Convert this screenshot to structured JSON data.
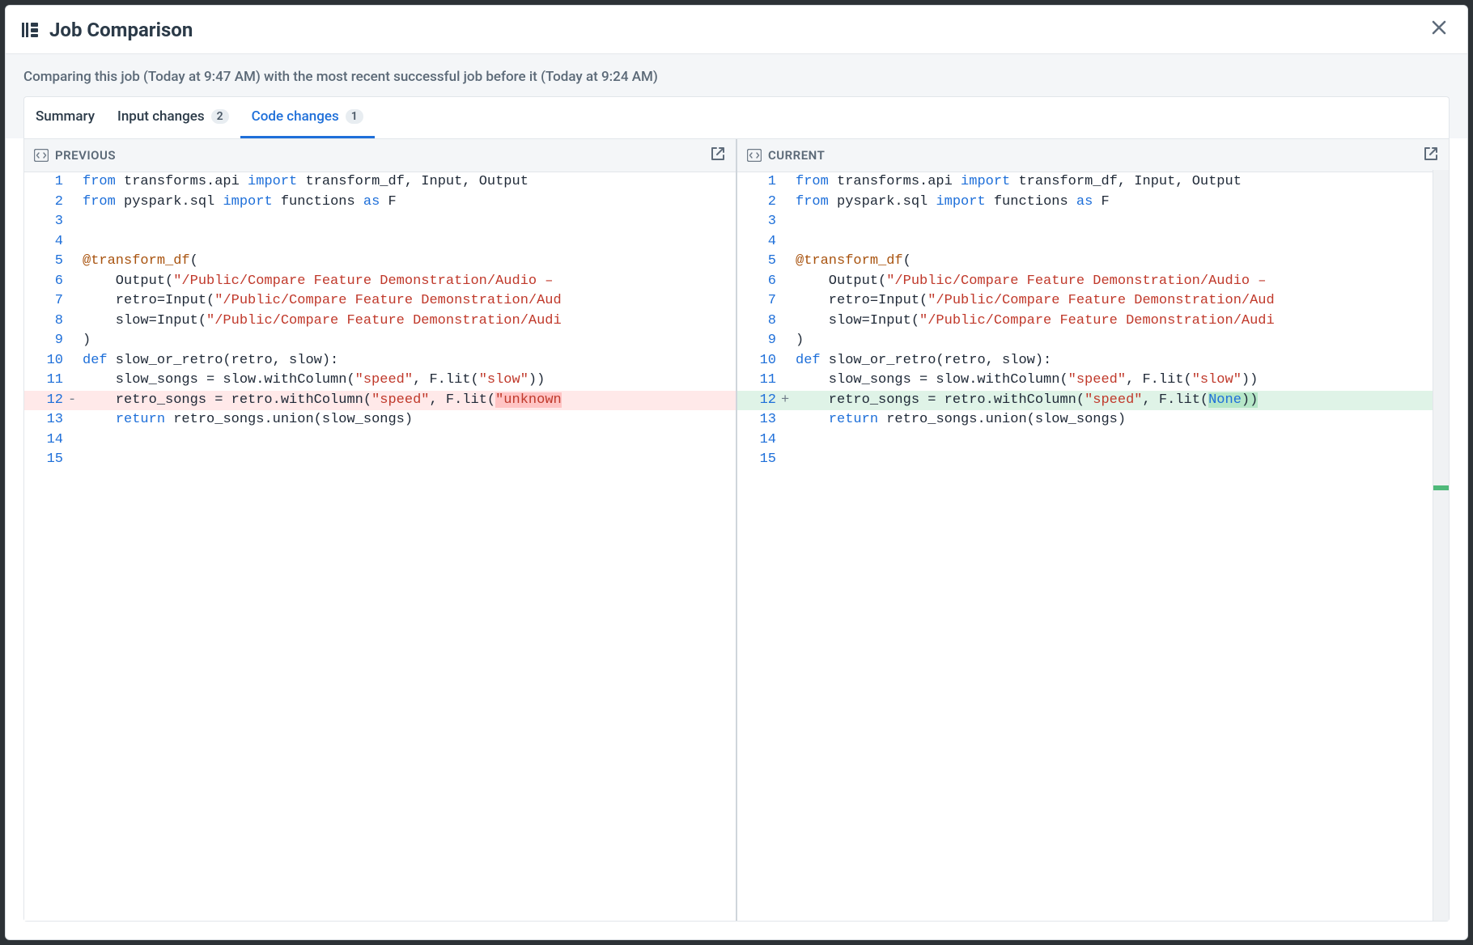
{
  "header": {
    "title": "Job Comparison"
  },
  "subheader": {
    "text": "Comparing this job (Today at 9:47 AM) with the most recent successful job before it (Today at 9:24 AM)"
  },
  "tabs": [
    {
      "label": "Summary",
      "badge": null,
      "active": false
    },
    {
      "label": "Input changes",
      "badge": "2",
      "active": false
    },
    {
      "label": "Code changes",
      "badge": "1",
      "active": true
    }
  ],
  "panes": {
    "previous": {
      "title": "PREVIOUS"
    },
    "current": {
      "title": "CURRENT"
    }
  },
  "code": {
    "previous": [
      {
        "n": 1,
        "diff": "",
        "tokens": [
          [
            "kw",
            "from"
          ],
          [
            "",
            " transforms.api "
          ],
          [
            "kw",
            "import"
          ],
          [
            "",
            " transform_df, Input, Output"
          ]
        ]
      },
      {
        "n": 2,
        "diff": "",
        "tokens": [
          [
            "kw",
            "from"
          ],
          [
            "",
            " pyspark.sql "
          ],
          [
            "kw",
            "import"
          ],
          [
            "",
            " functions "
          ],
          [
            "kw",
            "as"
          ],
          [
            "",
            " F"
          ]
        ]
      },
      {
        "n": 3,
        "diff": "",
        "tokens": [
          [
            "",
            ""
          ]
        ]
      },
      {
        "n": 4,
        "diff": "",
        "tokens": [
          [
            "",
            ""
          ]
        ]
      },
      {
        "n": 5,
        "diff": "",
        "tokens": [
          [
            "dec",
            "@transform_df"
          ],
          [
            "",
            "("
          ]
        ]
      },
      {
        "n": 6,
        "diff": "",
        "tokens": [
          [
            "",
            "    Output("
          ],
          [
            "str",
            "\"/Public/Compare Feature Demonstration/Audio – "
          ]
        ]
      },
      {
        "n": 7,
        "diff": "",
        "tokens": [
          [
            "",
            "    retro=Input("
          ],
          [
            "str",
            "\"/Public/Compare Feature Demonstration/Aud"
          ]
        ]
      },
      {
        "n": 8,
        "diff": "",
        "tokens": [
          [
            "",
            "    slow=Input("
          ],
          [
            "str",
            "\"/Public/Compare Feature Demonstration/Audi"
          ]
        ]
      },
      {
        "n": 9,
        "diff": "",
        "tokens": [
          [
            "",
            ")"
          ]
        ]
      },
      {
        "n": 10,
        "diff": "",
        "tokens": [
          [
            "kw",
            "def"
          ],
          [
            "",
            " slow_or_retro(retro, slow):"
          ]
        ]
      },
      {
        "n": 11,
        "diff": "",
        "tokens": [
          [
            "",
            "    slow_songs = slow.withColumn("
          ],
          [
            "str",
            "\"speed\""
          ],
          [
            "",
            ", F.lit("
          ],
          [
            "str",
            "\"slow\""
          ],
          [
            "",
            "))"
          ]
        ]
      },
      {
        "n": 12,
        "diff": "-",
        "tokens": [
          [
            "",
            "    retro_songs = retro.withColumn("
          ],
          [
            "str",
            "\"speed\""
          ],
          [
            "",
            ", F.lit("
          ],
          [
            "chg-open",
            ""
          ],
          [
            "str",
            "\"unknown"
          ],
          [
            "chg-close",
            ""
          ]
        ]
      },
      {
        "n": 13,
        "diff": "",
        "tokens": [
          [
            "",
            "    "
          ],
          [
            "kw",
            "return"
          ],
          [
            "",
            " retro_songs.union(slow_songs)"
          ]
        ]
      },
      {
        "n": 14,
        "diff": "",
        "tokens": [
          [
            "",
            ""
          ]
        ]
      },
      {
        "n": 15,
        "diff": "",
        "tokens": [
          [
            "",
            ""
          ]
        ]
      }
    ],
    "current": [
      {
        "n": 1,
        "diff": "",
        "tokens": [
          [
            "kw",
            "from"
          ],
          [
            "",
            " transforms.api "
          ],
          [
            "kw",
            "import"
          ],
          [
            "",
            " transform_df, Input, Output"
          ]
        ]
      },
      {
        "n": 2,
        "diff": "",
        "tokens": [
          [
            "kw",
            "from"
          ],
          [
            "",
            " pyspark.sql "
          ],
          [
            "kw",
            "import"
          ],
          [
            "",
            " functions "
          ],
          [
            "kw",
            "as"
          ],
          [
            "",
            " F"
          ]
        ]
      },
      {
        "n": 3,
        "diff": "",
        "tokens": [
          [
            "",
            ""
          ]
        ]
      },
      {
        "n": 4,
        "diff": "",
        "tokens": [
          [
            "",
            ""
          ]
        ]
      },
      {
        "n": 5,
        "diff": "",
        "tokens": [
          [
            "dec",
            "@transform_df"
          ],
          [
            "",
            "("
          ]
        ]
      },
      {
        "n": 6,
        "diff": "",
        "tokens": [
          [
            "",
            "    Output("
          ],
          [
            "str",
            "\"/Public/Compare Feature Demonstration/Audio – "
          ]
        ]
      },
      {
        "n": 7,
        "diff": "",
        "tokens": [
          [
            "",
            "    retro=Input("
          ],
          [
            "str",
            "\"/Public/Compare Feature Demonstration/Aud"
          ]
        ]
      },
      {
        "n": 8,
        "diff": "",
        "tokens": [
          [
            "",
            "    slow=Input("
          ],
          [
            "str",
            "\"/Public/Compare Feature Demonstration/Audi"
          ]
        ]
      },
      {
        "n": 9,
        "diff": "",
        "tokens": [
          [
            "",
            ")"
          ]
        ]
      },
      {
        "n": 10,
        "diff": "",
        "tokens": [
          [
            "kw",
            "def"
          ],
          [
            "",
            " slow_or_retro(retro, slow):"
          ]
        ]
      },
      {
        "n": 11,
        "diff": "",
        "tokens": [
          [
            "",
            "    slow_songs = slow.withColumn("
          ],
          [
            "str",
            "\"speed\""
          ],
          [
            "",
            ", F.lit("
          ],
          [
            "str",
            "\"slow\""
          ],
          [
            "",
            "))"
          ]
        ]
      },
      {
        "n": 12,
        "diff": "+",
        "tokens": [
          [
            "",
            "    retro_songs = retro.withColumn("
          ],
          [
            "str",
            "\"speed\""
          ],
          [
            "",
            ", F.lit("
          ],
          [
            "chg-open",
            ""
          ],
          [
            "none",
            "None"
          ],
          [
            "",
            "))"
          ],
          [
            "chg-close",
            ""
          ]
        ]
      },
      {
        "n": 13,
        "diff": "",
        "tokens": [
          [
            "",
            "    "
          ],
          [
            "kw",
            "return"
          ],
          [
            "",
            " retro_songs.union(slow_songs)"
          ]
        ]
      },
      {
        "n": 14,
        "diff": "",
        "tokens": [
          [
            "",
            ""
          ]
        ]
      },
      {
        "n": 15,
        "diff": "",
        "tokens": [
          [
            "",
            ""
          ]
        ]
      }
    ]
  }
}
